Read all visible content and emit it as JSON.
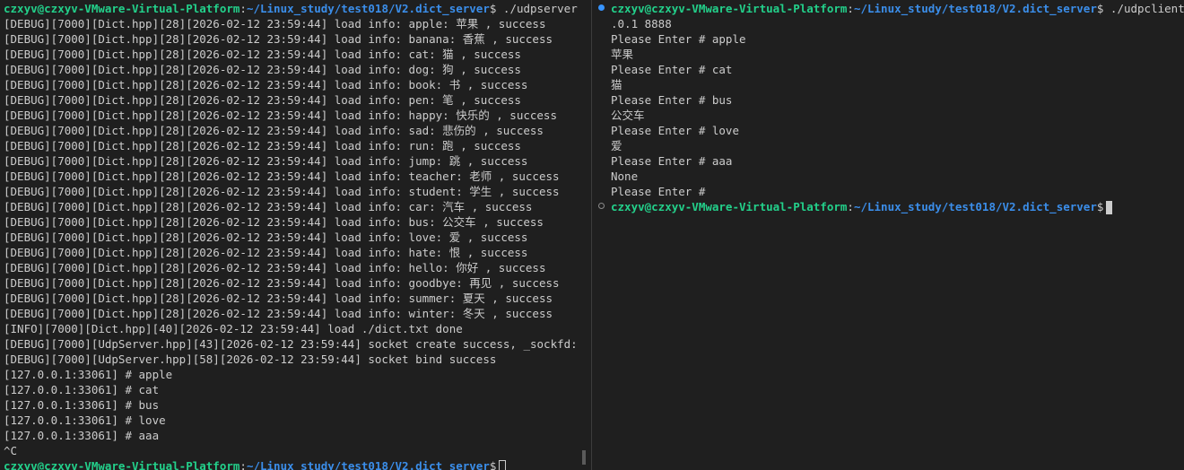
{
  "left": {
    "prompt": {
      "user": "czxyv@czxyv-VMware-Virtual-Platform",
      "path": "~/Linux_study/test018/V2.dict_server",
      "sym": "$",
      "command": " ./udpserver 8888"
    },
    "lines": [
      "[DEBUG][7000][Dict.hpp][28][2026-02-12 23:59:44] load info: apple: 苹果 , success",
      "[DEBUG][7000][Dict.hpp][28][2026-02-12 23:59:44] load info: banana: 香蕉 , success",
      "[DEBUG][7000][Dict.hpp][28][2026-02-12 23:59:44] load info: cat: 猫 , success",
      "[DEBUG][7000][Dict.hpp][28][2026-02-12 23:59:44] load info: dog: 狗 , success",
      "[DEBUG][7000][Dict.hpp][28][2026-02-12 23:59:44] load info: book: 书 , success",
      "[DEBUG][7000][Dict.hpp][28][2026-02-12 23:59:44] load info: pen: 笔 , success",
      "[DEBUG][7000][Dict.hpp][28][2026-02-12 23:59:44] load info: happy: 快乐的 , success",
      "[DEBUG][7000][Dict.hpp][28][2026-02-12 23:59:44] load info: sad: 悲伤的 , success",
      "[DEBUG][7000][Dict.hpp][28][2026-02-12 23:59:44] load info: run: 跑 , success",
      "[DEBUG][7000][Dict.hpp][28][2026-02-12 23:59:44] load info: jump: 跳 , success",
      "[DEBUG][7000][Dict.hpp][28][2026-02-12 23:59:44] load info: teacher: 老师 , success",
      "[DEBUG][7000][Dict.hpp][28][2026-02-12 23:59:44] load info: student: 学生 , success",
      "[DEBUG][7000][Dict.hpp][28][2026-02-12 23:59:44] load info: car: 汽车 , success",
      "[DEBUG][7000][Dict.hpp][28][2026-02-12 23:59:44] load info: bus: 公交车 , success",
      "[DEBUG][7000][Dict.hpp][28][2026-02-12 23:59:44] load info: love: 爱 , success",
      "[DEBUG][7000][Dict.hpp][28][2026-02-12 23:59:44] load info: hate: 恨 , success",
      "[DEBUG][7000][Dict.hpp][28][2026-02-12 23:59:44] load info: hello: 你好 , success",
      "[DEBUG][7000][Dict.hpp][28][2026-02-12 23:59:44] load info: goodbye: 再见 , success",
      "[DEBUG][7000][Dict.hpp][28][2026-02-12 23:59:44] load info: summer: 夏天 , success",
      "[DEBUG][7000][Dict.hpp][28][2026-02-12 23:59:44] load info: winter: 冬天 , success",
      "[INFO][7000][Dict.hpp][40][2026-02-12 23:59:44] load ./dict.txt done",
      "[DEBUG][7000][UdpServer.hpp][43][2026-02-12 23:59:44] socket create success, _sockfd: 3",
      "[DEBUG][7000][UdpServer.hpp][58][2026-02-12 23:59:44] socket bind success",
      "[127.0.0.1:33061] # apple",
      "[127.0.0.1:33061] # cat",
      "[127.0.0.1:33061] # bus",
      "[127.0.0.1:33061] # love",
      "[127.0.0.1:33061] # aaa",
      "^C"
    ],
    "bottom_prompt": {
      "user": "czxyv@czxyv-VMware-Virtual-Platform",
      "path": "~/Linux_study/test018/V2.dict_server",
      "sym": "$"
    }
  },
  "right": {
    "prompt": {
      "user": "czxyv@czxyv-VMware-Virtual-Platform",
      "path": "~/Linux_study/test018/V2.dict_server",
      "sym": "$",
      "command": " ./udpclient 127.0"
    },
    "lines": [
      ".0.1 8888",
      "Please Enter # apple",
      "苹果",
      "Please Enter # cat",
      "猫",
      "Please Enter # bus",
      "公交车",
      "Please Enter # love",
      "爱",
      "Please Enter # aaa",
      "None",
      "Please Enter #"
    ],
    "bottom_prompt": {
      "user": "czxyv@czxyv-VMware-Virtual-Platform",
      "path": "~/Linux_study/test018/V2.dict_server",
      "sym": "$"
    }
  }
}
